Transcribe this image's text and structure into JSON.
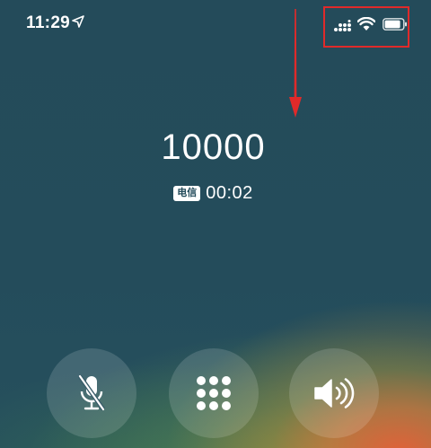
{
  "status_bar": {
    "time": "11:29",
    "icons": [
      "location-arrow-icon",
      "cellular-signal-icon",
      "wifi-icon",
      "battery-icon"
    ]
  },
  "call": {
    "number": "10000",
    "carrier": "电信",
    "duration": "00:02"
  },
  "controls": [
    {
      "name": "mute",
      "icon": "microphone-muted-icon"
    },
    {
      "name": "keypad",
      "icon": "keypad-icon"
    },
    {
      "name": "speaker",
      "icon": "speaker-icon"
    }
  ],
  "annotation": {
    "color": "#e02a2a",
    "type": "arrow-and-box"
  },
  "colors": {
    "background": "#244b5a",
    "button": "#ffffff24",
    "accent_warm": "#e86038"
  }
}
